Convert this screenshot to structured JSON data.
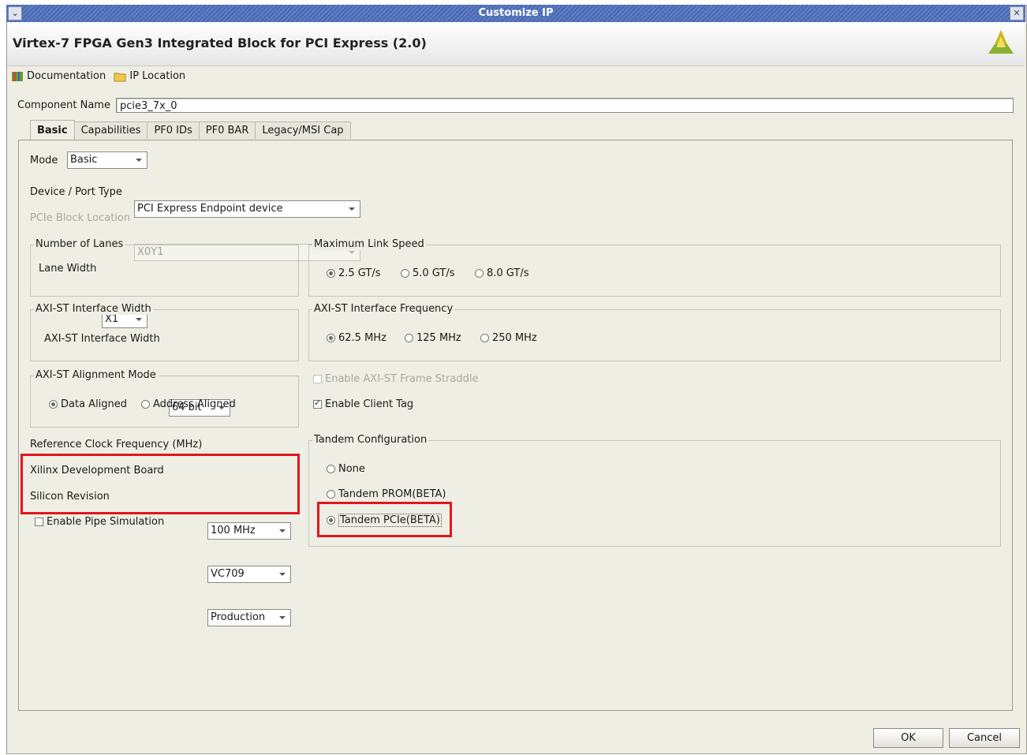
{
  "window": {
    "title": "Customize IP"
  },
  "header": {
    "title": "Virtex-7 FPGA Gen3 Integrated Block for PCI Express (2.0)"
  },
  "toolbar": {
    "documentation": "Documentation",
    "ip_location": "IP Location"
  },
  "component": {
    "label": "Component Name",
    "value": "pcie3_7x_0"
  },
  "tabs": [
    {
      "label": "Basic",
      "active": true
    },
    {
      "label": "Capabilities"
    },
    {
      "label": "PF0 IDs"
    },
    {
      "label": "PF0 BAR"
    },
    {
      "label": "Legacy/MSI Cap"
    }
  ],
  "mode": {
    "label": "Mode",
    "value": "Basic"
  },
  "device_port": {
    "label": "Device / Port Type",
    "value": "PCI Express Endpoint device"
  },
  "block_location": {
    "label": "PCIe Block Location",
    "value": "X0Y1"
  },
  "lanes": {
    "group": "Number of Lanes",
    "label": "Lane Width",
    "value": "X1"
  },
  "link_speed": {
    "group": "Maximum Link Speed",
    "options": [
      "2.5 GT/s",
      "5.0 GT/s",
      "8.0 GT/s"
    ],
    "selected": "2.5 GT/s"
  },
  "axi_width": {
    "group": "AXI-ST Interface Width",
    "label": "AXI-ST Interface Width",
    "value": "64 bit"
  },
  "axi_freq": {
    "group": "AXI-ST Interface Frequency",
    "options": [
      "62.5 MHz",
      "125 MHz",
      "250 MHz"
    ],
    "selected": "62.5 MHz"
  },
  "alignment": {
    "group": "AXI-ST Alignment Mode",
    "options": [
      "Data Aligned",
      "Address Aligned"
    ],
    "selected": "Data Aligned"
  },
  "straddle": {
    "label": "Enable AXI-ST Frame Straddle",
    "checked": false
  },
  "client_tag": {
    "label": "Enable Client Tag",
    "checked": true
  },
  "ref_clock": {
    "label": "Reference Clock Frequency (MHz)",
    "value": "100 MHz"
  },
  "dev_board": {
    "label": "Xilinx Development Board",
    "value": "VC709"
  },
  "silicon": {
    "label": "Silicon Revision",
    "value": "Production"
  },
  "pipe_sim": {
    "label": "Enable Pipe Simulation",
    "checked": false
  },
  "tandem": {
    "group": "Tandem Configuration",
    "options": [
      "None",
      "Tandem PROM(BETA)",
      "Tandem PCIe(BETA)"
    ],
    "selected": "Tandem PCIe(BETA)"
  },
  "buttons": {
    "ok": "OK",
    "cancel": "Cancel"
  },
  "colors": {
    "highlight": "#e0161f",
    "titlebar": "#5f7ec4"
  }
}
